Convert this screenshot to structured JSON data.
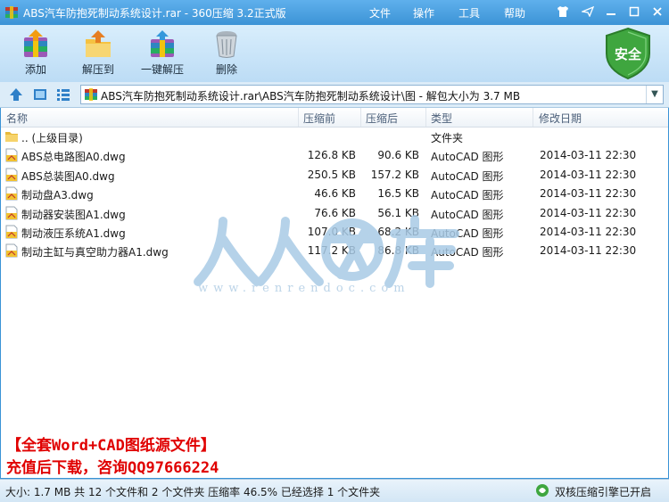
{
  "window": {
    "title": "ABS汽车防抱死制动系统设计.rar - 360压缩 3.2正式版",
    "menus": [
      "文件",
      "操作",
      "工具",
      "帮助"
    ]
  },
  "toolbar": {
    "add_label": "添加",
    "extract_label": "解压到",
    "oneclick_label": "一键解压",
    "delete_label": "删除",
    "security_label": "安全"
  },
  "address": {
    "path": "ABS汽车防抱死制动系统设计.rar\\ABS汽车防抱死制动系统设计\\图 - 解包大小为 3.7 MB"
  },
  "columns": {
    "name": "名称",
    "compressed": "压缩前",
    "packed": "压缩后",
    "type": "类型",
    "modified": "修改日期"
  },
  "files": [
    {
      "name": ".. (上级目录)",
      "before": "",
      "after": "",
      "type": "文件夹",
      "date": "",
      "icon": "folder-icon"
    },
    {
      "name": "ABS总电路图A0.dwg",
      "before": "126.8 KB",
      "after": "90.6 KB",
      "type": "AutoCAD 图形",
      "date": "2014-03-11 22:30",
      "icon": "dwg-file-icon"
    },
    {
      "name": "ABS总装图A0.dwg",
      "before": "250.5 KB",
      "after": "157.2 KB",
      "type": "AutoCAD 图形",
      "date": "2014-03-11 22:30",
      "icon": "dwg-file-icon"
    },
    {
      "name": "制动盘A3.dwg",
      "before": "46.6 KB",
      "after": "16.5 KB",
      "type": "AutoCAD 图形",
      "date": "2014-03-11 22:30",
      "icon": "dwg-file-icon"
    },
    {
      "name": "制动器安装图A1.dwg",
      "before": "76.6 KB",
      "after": "56.1 KB",
      "type": "AutoCAD 图形",
      "date": "2014-03-11 22:30",
      "icon": "dwg-file-icon"
    },
    {
      "name": "制动液压系统A1.dwg",
      "before": "107.0 KB",
      "after": "68.2 KB",
      "type": "AutoCAD 图形",
      "date": "2014-03-11 22:30",
      "icon": "dwg-file-icon"
    },
    {
      "name": "制动主缸与真空助力器A1.dwg",
      "before": "117.2 KB",
      "after": "86.8 KB",
      "type": "AutoCAD 图形",
      "date": "2014-03-11 22:30",
      "icon": "dwg-file-icon"
    }
  ],
  "watermark": {
    "url": "www.renrendoc.com"
  },
  "promo": {
    "line1": "【全套Word+CAD图纸源文件】",
    "line2": "充值后下载，咨询QQ97666224"
  },
  "status": {
    "summary": "大小: 1.7 MB 共 12 个文件和 2 个文件夹 压缩率 46.5% 已经选择 1 个文件夹",
    "engine": "双核压缩引擎已开启"
  },
  "colors": {
    "titlebar": "#3c93d6",
    "toolbar": "#cde6fa",
    "promo": "#e00000",
    "shield": "#3fa63f"
  }
}
